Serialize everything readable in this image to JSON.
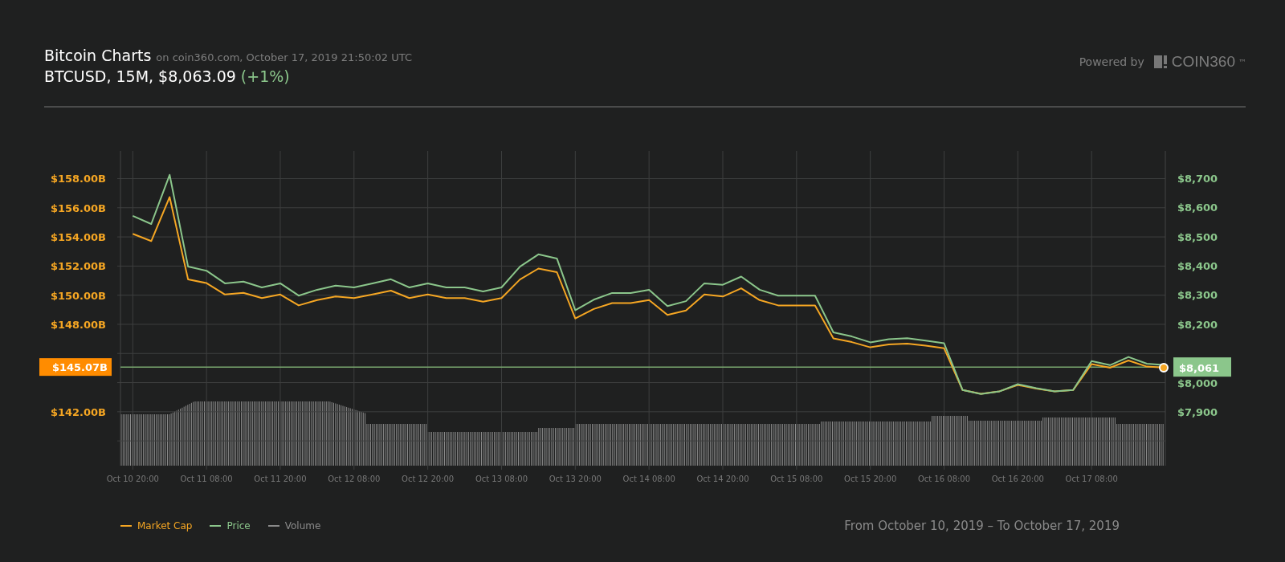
{
  "header": {
    "title": "Bitcoin Charts",
    "subtitle": "on coin360.com, October 17, 2019 21:50:02 UTC",
    "quote": "BTCUSD, 15M, $8,063.09",
    "change": "(+1%)",
    "powered_by": "Powered by",
    "brand": "COIN360",
    "trademark": "™"
  },
  "chart": {
    "chart_data": {
      "type": "line",
      "categories": [
        "Oct 10 20:00",
        null,
        null,
        null,
        "Oct 11 08:00",
        null,
        null,
        null,
        "Oct 11 20:00",
        null,
        null,
        null,
        "Oct 12 08:00",
        null,
        null,
        null,
        "Oct 12 20:00",
        null,
        null,
        null,
        "Oct 13 08:00",
        null,
        null,
        null,
        "Oct 13 20:00",
        null,
        null,
        null,
        "Oct 14 08:00",
        null,
        null,
        null,
        "Oct 14 20:00",
        null,
        null,
        null,
        "Oct 15 08:00",
        null,
        null,
        null,
        "Oct 15 20:00",
        null,
        null,
        null,
        "Oct 16 08:00",
        null,
        null,
        null,
        "Oct 16 20:00",
        null,
        null,
        null,
        "Oct 17 08:00",
        null,
        null,
        null,
        null
      ],
      "grid": true,
      "ylim": [
        138.3,
        159.9
      ],
      "yticks": [
        {
          "value": 158,
          "label": "$158.00B"
        },
        {
          "value": 156,
          "label": "$156.00B"
        },
        {
          "value": 154,
          "label": "$154.00B"
        },
        {
          "value": 152,
          "label": "$152.00B"
        },
        {
          "value": 150,
          "label": "$150.00B"
        },
        {
          "value": 148,
          "label": "$148.00B"
        },
        {
          "value": 142,
          "label": "$142.00B"
        }
      ],
      "y2lim": [
        7716,
        8793
      ],
      "y2ticks": [
        {
          "value": 8700,
          "label": "$8,700"
        },
        {
          "value": 8600,
          "label": "$8,600"
        },
        {
          "value": 8500,
          "label": "$8,500"
        },
        {
          "value": 8400,
          "label": "$8,400"
        },
        {
          "value": 8300,
          "label": "$8,300"
        },
        {
          "value": 8200,
          "label": "$8,200"
        },
        {
          "value": 8000,
          "label": "$8,000"
        },
        {
          "value": 7900,
          "label": "$7,900"
        }
      ],
      "series": [
        {
          "name": "Market Cap",
          "color": "#f5a623",
          "values": [
            154.21,
            153.71,
            156.73,
            151.08,
            150.83,
            150.05,
            150.16,
            149.8,
            150.05,
            149.3,
            149.66,
            149.91,
            149.8,
            150.05,
            150.31,
            149.8,
            150.05,
            149.8,
            149.8,
            149.55,
            149.8,
            151.08,
            151.83,
            151.58,
            148.4,
            149.05,
            149.46,
            149.46,
            149.66,
            148.65,
            148.95,
            150.05,
            149.91,
            150.47,
            149.66,
            149.3,
            149.3,
            149.3,
            147.03,
            146.78,
            146.42,
            146.62,
            146.67,
            146.53,
            146.36,
            143.49,
            143.23,
            143.4,
            143.84,
            143.59,
            143.4,
            143.49,
            145.27,
            145.02,
            145.52,
            145.1,
            145.02
          ]
        },
        {
          "name": "Price",
          "color": "#8bc68b",
          "axis": "y2",
          "values": [
            8571,
            8543,
            8711,
            8397,
            8383,
            8340,
            8346,
            8326,
            8340,
            8298,
            8318,
            8332,
            8326,
            8340,
            8354,
            8326,
            8340,
            8326,
            8326,
            8312,
            8326,
            8397,
            8439,
            8425,
            8248,
            8284,
            8307,
            8307,
            8318,
            8262,
            8279,
            8340,
            8335,
            8363,
            8318,
            8298,
            8298,
            8298,
            8172,
            8158,
            8138,
            8149,
            8152,
            8144,
            8135,
            7975,
            7961,
            7970,
            7995,
            7981,
            7970,
            7975,
            8074,
            8060,
            8088,
            8065,
            8060
          ]
        }
      ],
      "ref_lines": [
        {
          "axis": "y",
          "value": 145.07,
          "label": "$145.07B"
        }
      ]
    },
    "current_price_tag": "$8,061"
  },
  "volume_legend": {
    "label": "Volume",
    "color": "#8a8a8a"
  },
  "date_range": "From October 10, 2019 – To October 17, 2019"
}
